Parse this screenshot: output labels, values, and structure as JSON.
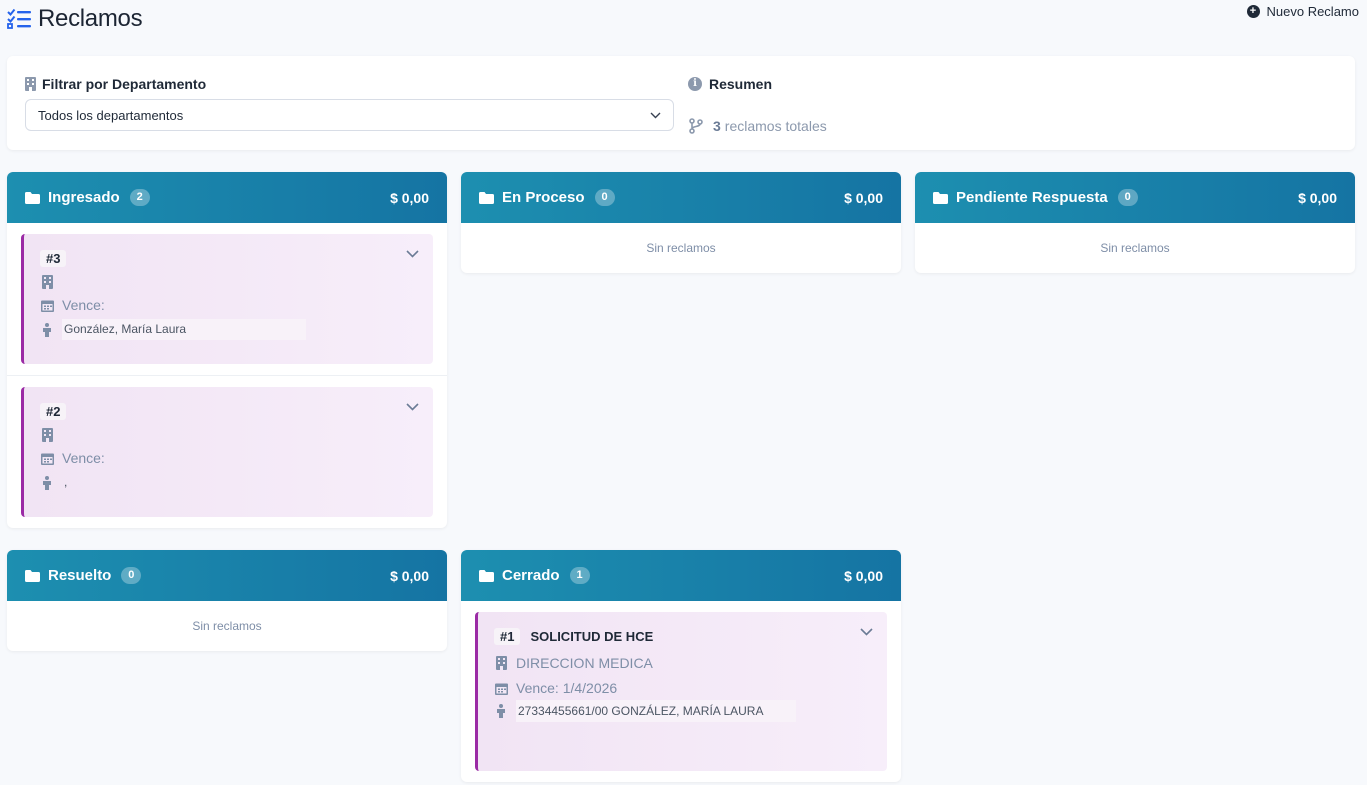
{
  "header": {
    "title": "Reclamos",
    "new_button": "Nuevo Reclamo"
  },
  "filter": {
    "label": "Filtrar por Departamento",
    "selected": "Todos los departamentos"
  },
  "summary": {
    "label": "Resumen",
    "count": "3",
    "count_text": "reclamos totales"
  },
  "columns": [
    {
      "title": "Ingresado",
      "count": "2",
      "amount": "$ 0,00",
      "cards": [
        {
          "id": "#3",
          "subject": "",
          "department": "",
          "due": "Vence:",
          "patient": "González, María Laura"
        },
        {
          "id": "#2",
          "subject": "",
          "department": "",
          "due": "Vence:",
          "patient": ","
        }
      ]
    },
    {
      "title": "En Proceso",
      "count": "0",
      "amount": "$ 0,00",
      "empty": "Sin reclamos"
    },
    {
      "title": "Pendiente Respuesta",
      "count": "0",
      "amount": "$ 0,00",
      "empty": "Sin reclamos"
    },
    {
      "title": "Resuelto",
      "count": "0",
      "amount": "$ 0,00",
      "empty": "Sin reclamos"
    },
    {
      "title": "Cerrado",
      "count": "1",
      "amount": "$ 0,00",
      "cards": [
        {
          "id": "#1",
          "subject": "SOLICITUD DE HCE",
          "department": "DIRECCION MEDICA",
          "due": "Vence: 1/4/2026",
          "patient": "27334455661/00 GONZÁLEZ, MARÍA LAURA"
        }
      ]
    }
  ],
  "colors": {
    "header_gradient_start": "#1d8fb0",
    "header_gradient_end": "#1574a3",
    "card_accent": "#9b2aa5",
    "muted": "#7e8ea7",
    "brand_icon": "#2563eb"
  }
}
